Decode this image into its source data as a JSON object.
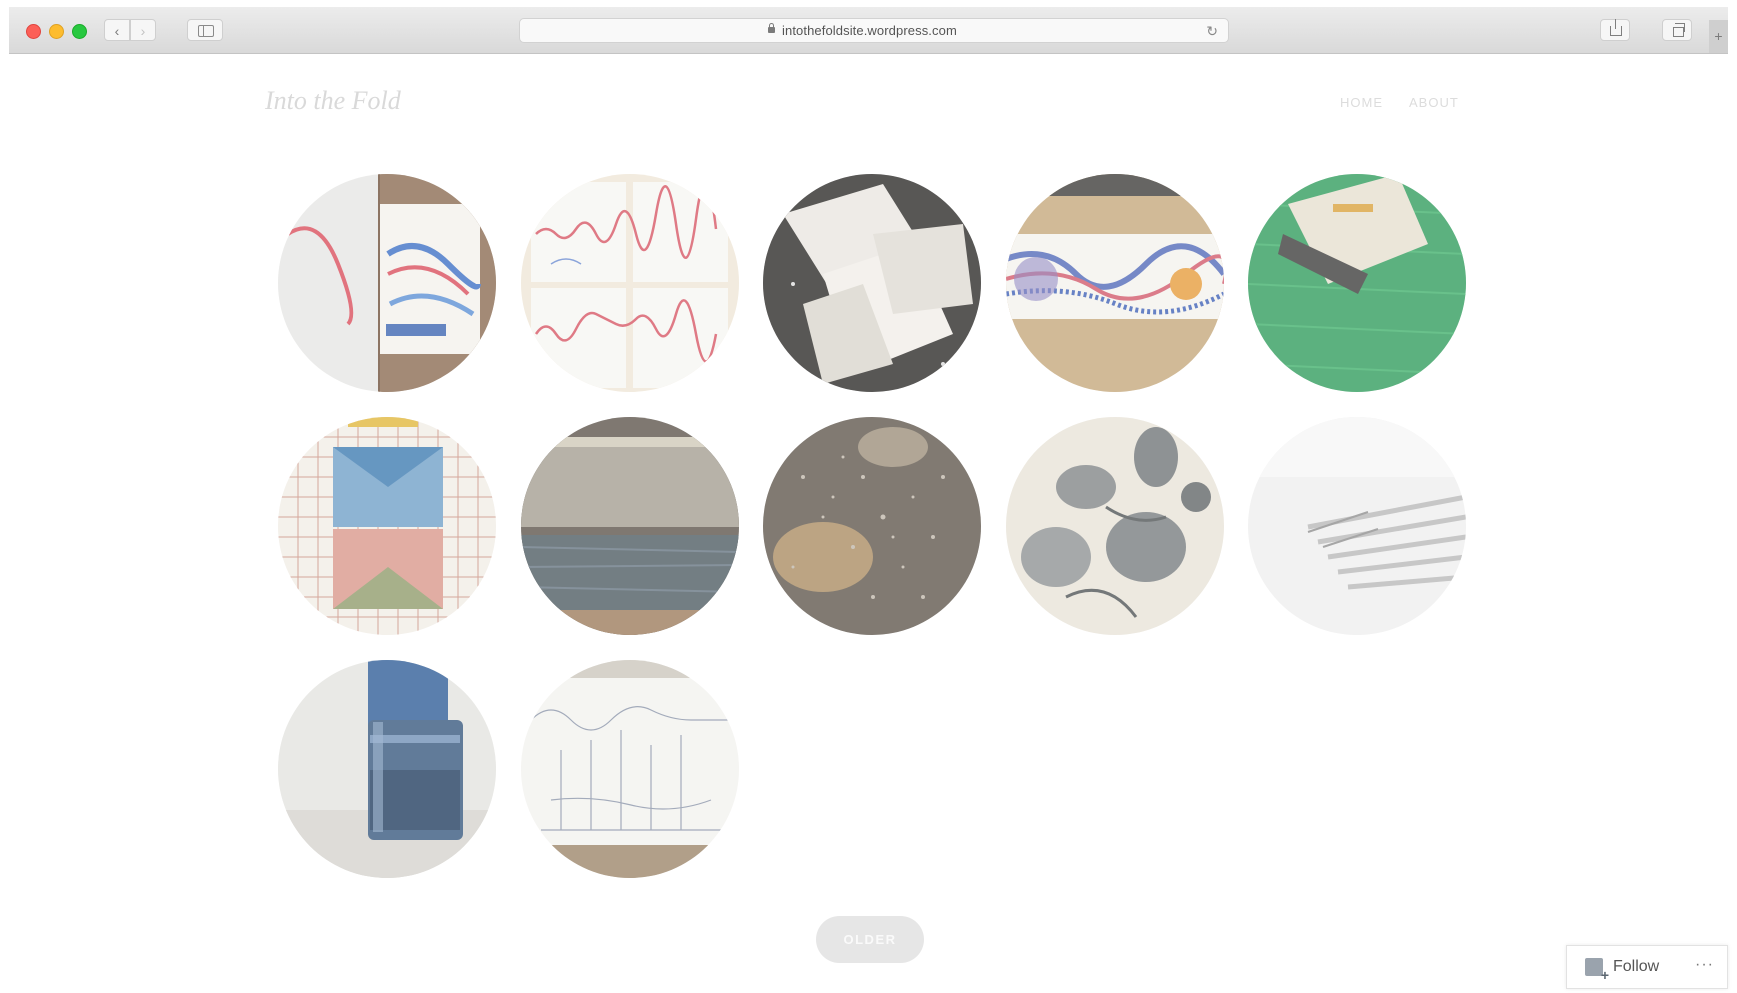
{
  "browser": {
    "url": "intothefoldsite.wordpress.com",
    "back_glyph": "‹",
    "forward_glyph": "›",
    "reload_glyph": "↻",
    "new_tab_glyph": "+",
    "icons": [
      "close-button",
      "minimize-button",
      "zoom-button",
      "back-icon",
      "forward-icon",
      "sidebar-icon",
      "lock-icon",
      "reload-icon",
      "share-icon",
      "tabs-icon"
    ]
  },
  "site": {
    "title": "Into the Fold",
    "menu": [
      "HOME",
      "ABOUT"
    ]
  },
  "gallery": {
    "tiles": [
      {
        "subject": "red and blue ribbon sketches"
      },
      {
        "subject": "sketch grid with red wave lines"
      },
      {
        "subject": "white paper squares on black"
      },
      {
        "subject": "patterned ribbon drawing on tan"
      },
      {
        "subject": "paper on green surface"
      },
      {
        "subject": "geometric quilt on grid paper"
      },
      {
        "subject": "metal sheet on grey surface"
      },
      {
        "subject": "speckled bronze surface"
      },
      {
        "subject": "grey leaf and flower print"
      },
      {
        "subject": "pale striped fabric"
      },
      {
        "subject": "blue glass jar"
      },
      {
        "subject": "pencil line drawings"
      }
    ]
  },
  "pagination": {
    "older_label": "OLDER"
  },
  "follow_widget": {
    "label": "Follow",
    "more": "···"
  },
  "colors": {
    "toolbar": "#dedede",
    "muted_text": "#dcdcdc",
    "button_bg": "#e6e6e6"
  }
}
